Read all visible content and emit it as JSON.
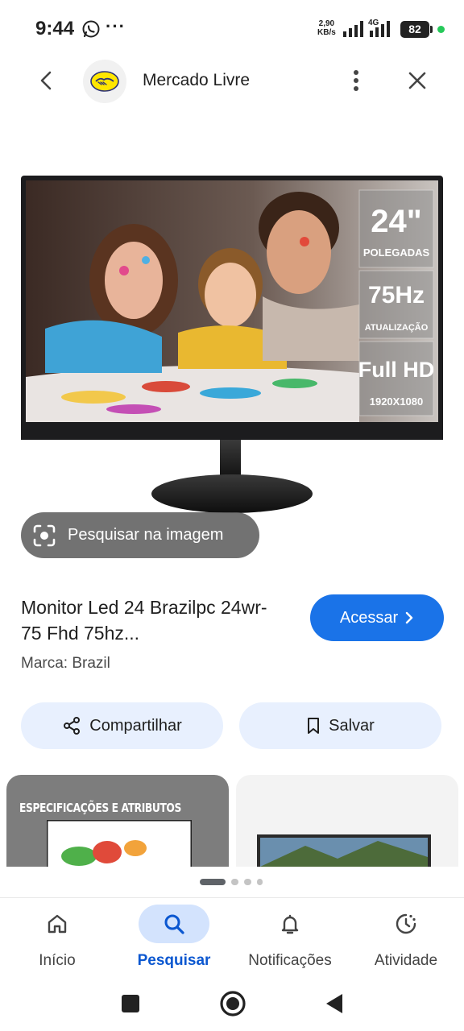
{
  "status_bar": {
    "time": "9:44",
    "more": "···",
    "net_speed_value": "2,90",
    "net_speed_unit": "KB/s",
    "network_type": "4G",
    "battery": "82",
    "battery_color": "#222222"
  },
  "header": {
    "site_name": "Mercado Livre"
  },
  "product_image": {
    "badge_size": "24\"",
    "badge_size_unit": "POLEGADAS",
    "badge_rate": "75Hz",
    "badge_rate_unit": "ATUALIZAÇÃO",
    "badge_res": "Full HD",
    "badge_res_detail": "1920X1080"
  },
  "lens": {
    "label": "Pesquisar na imagem"
  },
  "product": {
    "title": "Monitor Led 24 Brazilpc 24wr-75 Fhd 75hz...",
    "brand": "Marca: Brazil",
    "visit_label": "Acessar",
    "accent_color": "#1a73e8"
  },
  "actions": {
    "share_label": "Compartilhar",
    "save_label": "Salvar"
  },
  "related": {
    "card1_text": "ESPECIFICAÇÕES E ATRIBUTOS"
  },
  "bottom_nav": {
    "items": [
      {
        "label": "Início",
        "icon": "home-icon"
      },
      {
        "label": "Pesquisar",
        "icon": "search-icon",
        "active": true
      },
      {
        "label": "Notificações",
        "icon": "bell-icon"
      },
      {
        "label": "Atividade",
        "icon": "activity-icon"
      }
    ],
    "active_color": "#0b57d0"
  }
}
